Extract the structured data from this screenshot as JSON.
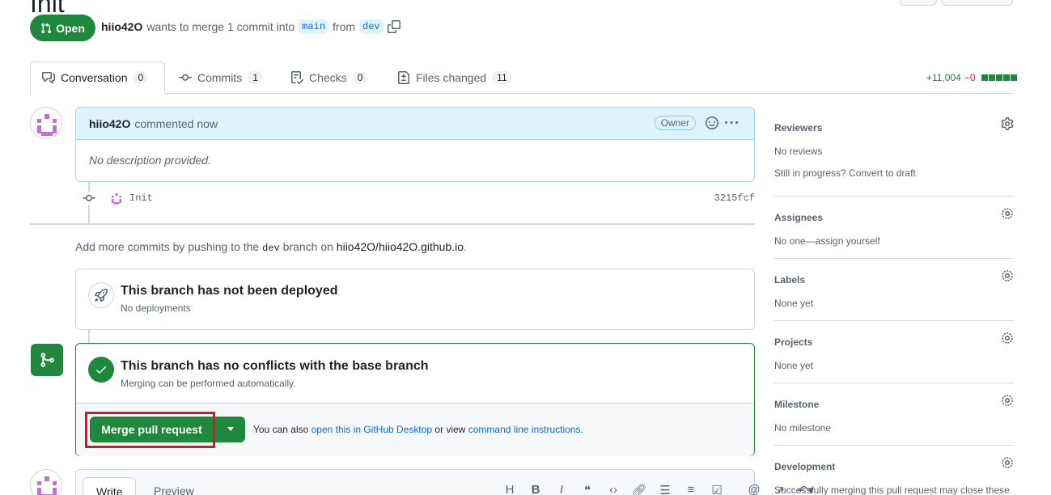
{
  "pr": {
    "title": "Init",
    "state": "Open",
    "author": "hiio42O",
    "meta_text": "wants to merge 1 commit into",
    "base_branch": "main",
    "from_text": "from",
    "head_branch": "dev"
  },
  "tabs": [
    {
      "label": "Conversation",
      "count": "0"
    },
    {
      "label": "Commits",
      "count": "1"
    },
    {
      "label": "Checks",
      "count": "0"
    },
    {
      "label": "Files changed",
      "count": "11"
    }
  ],
  "diffstat": {
    "additions": "+11,004",
    "deletions": "−0"
  },
  "comment": {
    "author": "hiio42O",
    "action": "commented now",
    "badge": "Owner",
    "body": "No description provided."
  },
  "commit": {
    "message": "Init",
    "sha": "3215fcf"
  },
  "push_info": {
    "prefix": "Add more commits by pushing to the",
    "branch": "dev",
    "middle": "branch on",
    "repo": "hiio42O/hiio42O.github.io",
    "suffix": "."
  },
  "deploy": {
    "title": "This branch has not been deployed",
    "subtitle": "No deployments"
  },
  "merge": {
    "title": "This branch has no conflicts with the base branch",
    "subtitle": "Merging can be performed automatically.",
    "button": "Merge pull request",
    "help_prefix": "You can also",
    "help_link1": "open this in GitHub Desktop",
    "help_middle": "or view",
    "help_link2": "command line instructions",
    "help_suffix": "."
  },
  "editor": {
    "write_tab": "Write",
    "preview_tab": "Preview",
    "toolbar": [
      "H",
      "B",
      "I",
      "quote",
      "code",
      "link",
      "ul",
      "ol",
      "task",
      "@",
      "ref",
      "undo"
    ]
  },
  "sidebar": {
    "reviewers": {
      "title": "Reviewers",
      "value": "No reviews",
      "extra": "Still in progress? Convert to draft"
    },
    "assignees": {
      "title": "Assignees",
      "value": "No one—assign yourself"
    },
    "labels": {
      "title": "Labels",
      "value": "None yet"
    },
    "projects": {
      "title": "Projects",
      "value": "None yet"
    },
    "milestone": {
      "title": "Milestone",
      "value": "No milestone"
    },
    "development": {
      "title": "Development",
      "value": "Successfully merging this pull request may close these"
    }
  },
  "colors": {
    "merge_green": "#1f883d",
    "highlight_red": "#e0141e",
    "link_blue": "#0969da"
  }
}
